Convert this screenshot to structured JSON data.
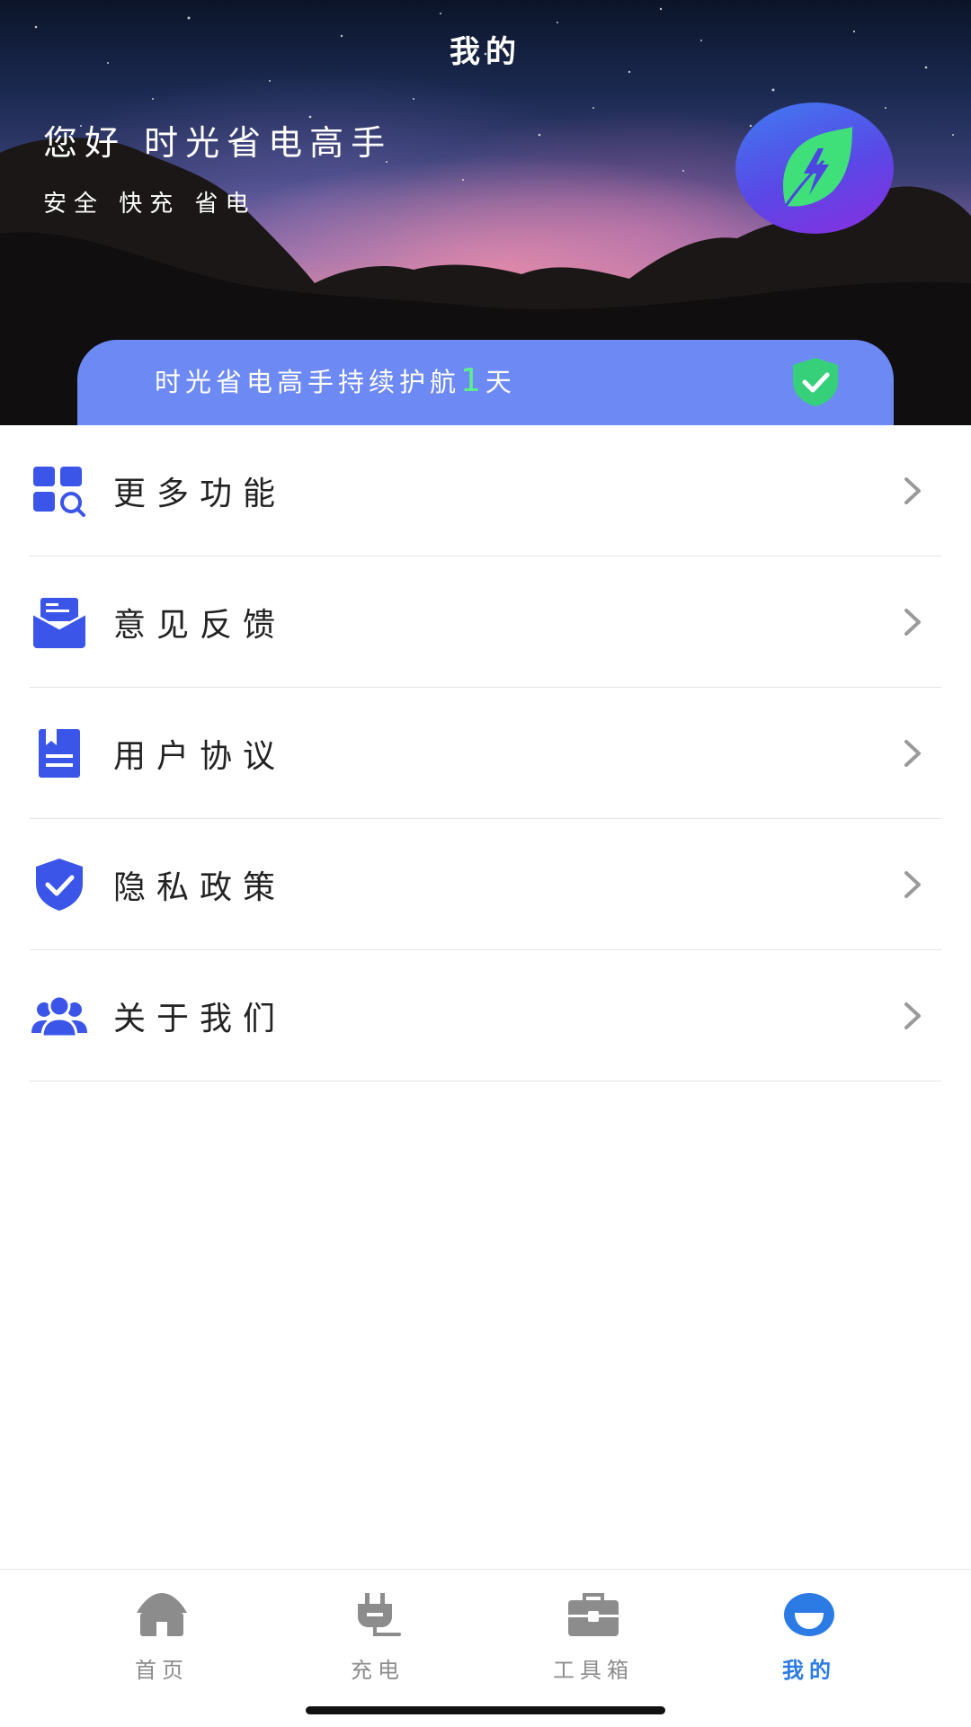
{
  "header": {
    "title": "我的",
    "greeting": "您好 时光省电高手",
    "tagline": "安全 快充 省电",
    "avatar_icon": "leaf-bolt-icon",
    "banner": {
      "prefix": "时光省电高手持续护航",
      "days": "1",
      "suffix": "天",
      "icon": "shield-check-icon"
    }
  },
  "menu": {
    "items": [
      {
        "label": "更多功能",
        "icon": "grid-search-icon"
      },
      {
        "label": "意见反馈",
        "icon": "feedback-envelope-icon"
      },
      {
        "label": "用户协议",
        "icon": "document-icon"
      },
      {
        "label": "隐私政策",
        "icon": "shield-check-icon"
      },
      {
        "label": "关于我们",
        "icon": "users-icon"
      }
    ]
  },
  "tabbar": {
    "tabs": [
      {
        "label": "首页",
        "icon": "home-icon",
        "active": false
      },
      {
        "label": "充电",
        "icon": "plug-icon",
        "active": false
      },
      {
        "label": "工具箱",
        "icon": "toolbox-icon",
        "active": false
      },
      {
        "label": "我的",
        "icon": "profile-icon",
        "active": true
      }
    ]
  },
  "colors": {
    "accent": "#3a55e8",
    "banner": "#6d89f4",
    "tab_active": "#2c7be5",
    "tab_inactive": "#8c8c8c",
    "highlight_green": "#5cf08a"
  }
}
